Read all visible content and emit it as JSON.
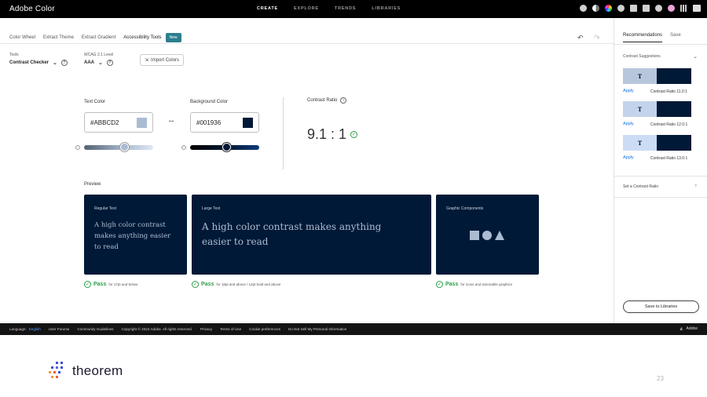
{
  "topbar": {
    "brand": "Adobe Color",
    "nav": [
      "CREATE",
      "EXPLORE",
      "TRENDS",
      "LIBRARIES"
    ],
    "active_nav": "CREATE",
    "icons": [
      "settings-icon",
      "theme-icon",
      "color-wheel-icon",
      "help-icon",
      "feedback-icon",
      "chat-icon",
      "notifications-icon",
      "avatar",
      "apps-grid-icon",
      "adobe-icon"
    ]
  },
  "tabs": {
    "items": [
      "Color Wheel",
      "Extract Theme",
      "Extract Gradient",
      "Accessibility Tools"
    ],
    "badge": "New"
  },
  "tools": {
    "label": "Tools",
    "value": "Contrast Checker",
    "wcag_label": "WCAG 2.1 Level",
    "wcag_value": "AAA",
    "import_label": "Import Colors"
  },
  "text_color": {
    "label": "Text Color",
    "hex": "#ABBCD2",
    "slider_level": 0.58
  },
  "background_color": {
    "label": "Background Color",
    "hex": "#001936",
    "slider_level": 0.53
  },
  "contrast": {
    "label": "Contrast Ratio",
    "value": "9.1 : 1"
  },
  "preview": {
    "label": "Preview",
    "cards": [
      {
        "caption": "Regular Text",
        "text": "A high color contrast makes anything easier to read",
        "pass": "Pass",
        "note": "for 17pt and below"
      },
      {
        "caption": "Large Text",
        "text": "A high color contrast makes anything easier to read",
        "pass": "Pass",
        "note": "for 18pt and above / 14pt bold and above"
      },
      {
        "caption": "Graphic Components",
        "pass": "Pass",
        "note": "for icons and actionable graphics"
      }
    ]
  },
  "right_panel": {
    "tabs": [
      "Recommendations",
      "Save"
    ],
    "section": "Contrast Suggestions",
    "suggestions": [
      {
        "glyph": "T",
        "color": "#b8c6dc",
        "apply": "Apply",
        "ratio": "Contrast Ratio 11.0:1"
      },
      {
        "glyph": "T",
        "color": "#c3d3eb",
        "apply": "Apply",
        "ratio": "Contrast Ratio 12.0:1"
      },
      {
        "glyph": "T",
        "color": "#ccdcf5",
        "apply": "Apply",
        "ratio": "Contrast Ratio 13.0:1"
      }
    ],
    "set_ratio": "Set a Contrast Ratio",
    "save_button": "Save to Libraries"
  },
  "footer": {
    "language_label": "Language:",
    "language_value": "English",
    "links": [
      "User Forums",
      "Community Guidelines",
      "Copyright © 2022 Adobe. All rights reserved.",
      "Privacy",
      "Terms of Use",
      "Cookie preferences",
      "Do Not Sell My Personal Information"
    ],
    "adobe": "Adobe"
  },
  "slide": {
    "logo_text": "theorem",
    "page_number": "23"
  }
}
